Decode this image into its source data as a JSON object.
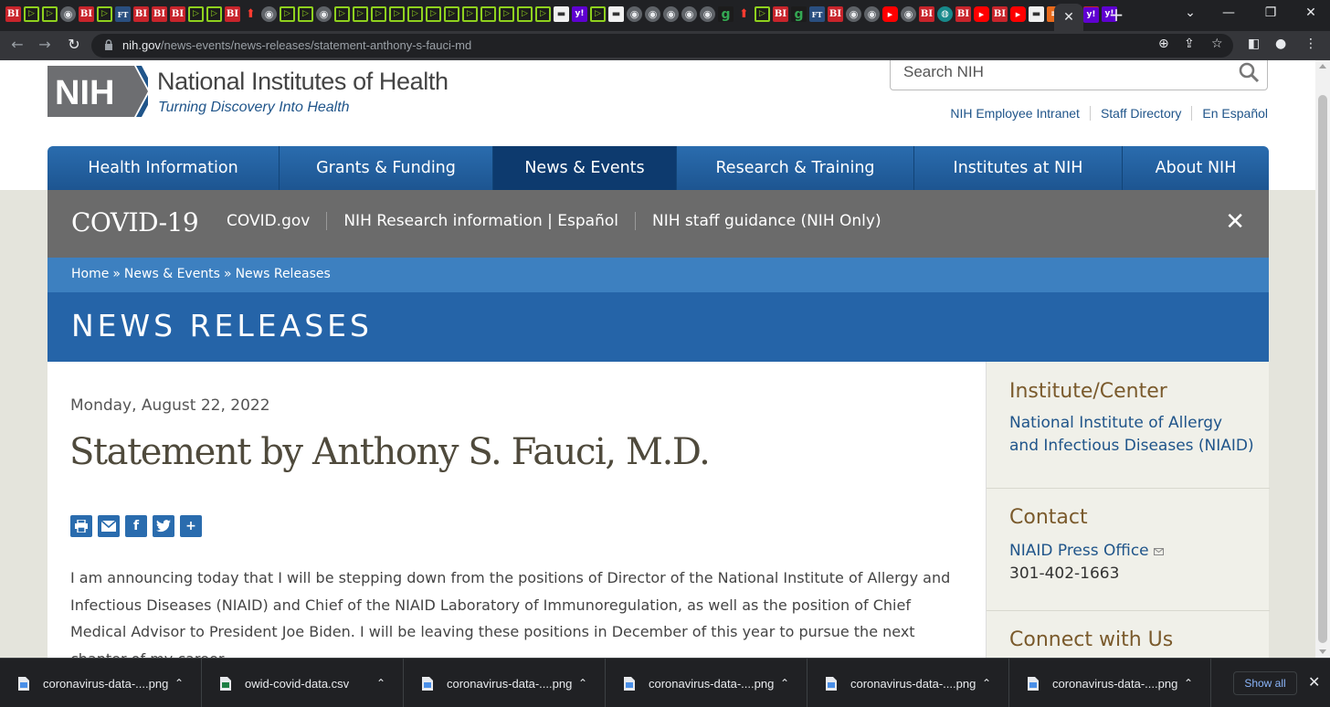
{
  "browser": {
    "url_host": "nih.gov",
    "url_path": "/news-events/news-releases/statement-anthony-s-fauci-md",
    "tab_icons": [
      "bi",
      "play",
      "play",
      "globe",
      "bi",
      "play",
      "ft",
      "bi",
      "bi",
      "bi",
      "play",
      "play",
      "bi",
      "red",
      "globe",
      "play",
      "play",
      "globe",
      "play",
      "play",
      "play",
      "play",
      "play",
      "play",
      "play",
      "play",
      "play",
      "play",
      "play",
      "play",
      "white",
      "yh",
      "play",
      "white",
      "globe",
      "globe",
      "globe",
      "globe",
      "globe",
      "g",
      "red",
      "play",
      "bi",
      "g",
      "ft",
      "bi",
      "globe",
      "globe",
      "yt",
      "globe",
      "bi",
      "teal",
      "bi",
      "yt",
      "bi",
      "yt",
      "white",
      "orange",
      "bi",
      "bi",
      "yh"
    ]
  },
  "header": {
    "logo_abbrev": "NIH",
    "org_name": "National Institutes of Health",
    "tagline": "Turning Discovery Into Health",
    "search_placeholder": "Search NIH",
    "utility_links": [
      "NIH Employee Intranet",
      "Staff Directory",
      "En Español"
    ]
  },
  "nav": {
    "items": [
      {
        "label": "Health Information",
        "active": false
      },
      {
        "label": "Grants & Funding",
        "active": false
      },
      {
        "label": "News & Events",
        "active": true
      },
      {
        "label": "Research & Training",
        "active": false
      },
      {
        "label": "Institutes at NIH",
        "active": false
      },
      {
        "label": "About NIH",
        "active": false
      }
    ]
  },
  "covid": {
    "title": "COVID-19",
    "links": [
      "COVID.gov",
      "NIH Research information | Español",
      "NIH staff guidance (NIH Only)"
    ],
    "close": "✕"
  },
  "breadcrumb": [
    "Home",
    "News & Events",
    "News Releases"
  ],
  "section": {
    "title": "NEWS RELEASES"
  },
  "release": {
    "date": "Monday, August 22, 2022",
    "title": "Statement by Anthony S. Fauci, M.D.",
    "body": "I am announcing today that I will be stepping down from the positions of Director of the National Institute of Allergy and Infectious Diseases (NIAID) and Chief of the NIAID Laboratory of Immunoregulation, as well as the position of Chief Medical Advisor to President Joe Biden. I will be leaving these positions in December of this year to pursue the next chapter of my career."
  },
  "sidebar": {
    "institute_heading": "Institute/Center",
    "institute_link": "National Institute of Allergy and Infectious Diseases (NIAID)",
    "contact_heading": "Contact",
    "contact_link": "NIAID Press Office",
    "contact_phone": "301-402-1663",
    "connect_heading": "Connect with Us"
  },
  "downloads": {
    "items": [
      {
        "name": "coronavirus-data-....png",
        "type": "png"
      },
      {
        "name": "owid-covid-data.csv",
        "type": "csv"
      },
      {
        "name": "coronavirus-data-....png",
        "type": "png"
      },
      {
        "name": "coronavirus-data-....png",
        "type": "png"
      },
      {
        "name": "coronavirus-data-....png",
        "type": "png"
      },
      {
        "name": "coronavirus-data-....png",
        "type": "png"
      }
    ],
    "show_all": "Show all"
  }
}
